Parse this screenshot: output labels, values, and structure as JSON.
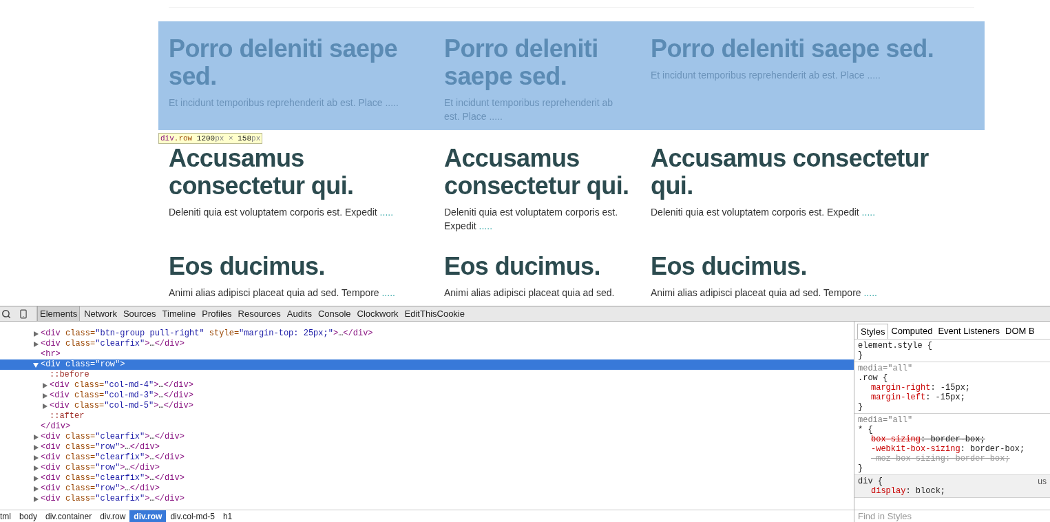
{
  "page": {
    "rows": [
      {
        "highlighted": true,
        "columns": [
          {
            "heading": "Porro deleniti saepe sed.",
            "text": "Et incidunt temporibus reprehenderit ab est. Place",
            "link": "....."
          },
          {
            "heading": "Porro deleniti saepe sed.",
            "text": "Et incidunt temporibus reprehenderit ab est. Place",
            "link": "....."
          },
          {
            "heading": "Porro deleniti saepe sed.",
            "text": "Et incidunt temporibus reprehenderit ab est. Place",
            "link": "....."
          }
        ]
      },
      {
        "highlighted": false,
        "columns": [
          {
            "heading": "Accusamus consectetur qui.",
            "text": "Deleniti quia est voluptatem corporis est. Expedit",
            "link": "....."
          },
          {
            "heading": "Accusamus consectetur qui.",
            "text": "Deleniti quia est voluptatem corporis est. Expedit",
            "link": "....."
          },
          {
            "heading": "Accusamus consectetur qui.",
            "text": "Deleniti quia est voluptatem corporis est. Expedit",
            "link": "....."
          }
        ]
      },
      {
        "highlighted": false,
        "columns": [
          {
            "heading": "Eos ducimus.",
            "text": "Animi alias adipisci placeat quia ad sed. Tempore",
            "link": "....."
          },
          {
            "heading": "Eos ducimus.",
            "text": "Animi alias adipisci placeat quia ad sed."
          },
          {
            "heading": "Eos ducimus.",
            "text": "Animi alias adipisci placeat quia ad sed. Tempore",
            "link": "....."
          }
        ]
      }
    ],
    "tooltip": [
      {
        "kind": "tag",
        "text": "div"
      },
      {
        "kind": "class",
        "text": ".row"
      },
      {
        "kind": "number",
        "text": " 1200"
      },
      {
        "kind": "unit",
        "text": "px"
      },
      {
        "kind": "unit",
        "text": " × "
      },
      {
        "kind": "number",
        "text": "158"
      },
      {
        "kind": "unit",
        "text": "px"
      }
    ]
  },
  "devtools": {
    "tabs": [
      {
        "label": "Elements",
        "selected": true
      },
      {
        "label": "Network",
        "selected": false
      },
      {
        "label": "Sources",
        "selected": false
      },
      {
        "label": "Timeline",
        "selected": false
      },
      {
        "label": "Profiles",
        "selected": false
      },
      {
        "label": "Resources",
        "selected": false
      },
      {
        "label": "Audits",
        "selected": false
      },
      {
        "label": "Console",
        "selected": false
      },
      {
        "label": "Clockwork",
        "selected": false
      },
      {
        "label": "EditThisCookie",
        "selected": false
      }
    ],
    "dom_tree": [
      {
        "kind": "element",
        "text": "<div class=\"btn-group pull-right\" style=\"margin-top: 25px;\">…</div>",
        "expanded": false,
        "selected": false
      },
      {
        "kind": "element",
        "text": "<div class=\"clearfix\">…</div>",
        "expanded": false,
        "selected": false
      },
      {
        "kind": "leaf",
        "text": "<hr>"
      },
      {
        "kind": "element",
        "text": "<div class=\"row\">",
        "expanded": true,
        "selected": true,
        "closing": "</div>",
        "children": [
          {
            "kind": "pseudo",
            "text": "::before"
          },
          {
            "kind": "element",
            "text": "<div class=\"col-md-4\">…</div>",
            "expanded": false,
            "selected": false
          },
          {
            "kind": "element",
            "text": "<div class=\"col-md-3\">…</div>",
            "expanded": false,
            "selected": false
          },
          {
            "kind": "element",
            "text": "<div class=\"col-md-5\">…</div>",
            "expanded": false,
            "selected": false
          },
          {
            "kind": "pseudo",
            "text": "::after"
          }
        ]
      },
      {
        "kind": "element",
        "text": "<div class=\"clearfix\">…</div>",
        "expanded": false,
        "selected": false
      },
      {
        "kind": "element",
        "text": "<div class=\"row\">…</div>",
        "expanded": false,
        "selected": false
      },
      {
        "kind": "element",
        "text": "<div class=\"clearfix\">…</div>",
        "expanded": false,
        "selected": false
      },
      {
        "kind": "element",
        "text": "<div class=\"row\">…</div>",
        "expanded": false,
        "selected": false
      },
      {
        "kind": "element",
        "text": "<div class=\"clearfix\">…</div>",
        "expanded": false,
        "selected": false
      },
      {
        "kind": "element",
        "text": "<div class=\"row\">…</div>",
        "expanded": false,
        "selected": false
      },
      {
        "kind": "element",
        "text": "<div class=\"clearfix\">…</div>",
        "expanded": false,
        "selected": false
      }
    ],
    "breadcrumbs": [
      {
        "label": "tml",
        "selected": false
      },
      {
        "label": "body",
        "selected": false
      },
      {
        "label": "div.container",
        "selected": false
      },
      {
        "label": "div.row",
        "selected": false
      },
      {
        "label": "div.row",
        "selected": true
      },
      {
        "label": "div.col-md-5",
        "selected": false
      },
      {
        "label": "h1",
        "selected": false
      }
    ],
    "styles": {
      "tabs": [
        {
          "label": "Styles",
          "selected": true
        },
        {
          "label": "Computed",
          "selected": false
        },
        {
          "label": "Event Listeners",
          "selected": false
        },
        {
          "label": "DOM B",
          "selected": false
        }
      ],
      "rules": [
        {
          "kind": "author",
          "selector": "element.style {",
          "close": "}"
        },
        {
          "kind": "author",
          "media": "media=\"all\"",
          "selector": ".row {",
          "close": "}",
          "properties": [
            {
              "name": "margin-right",
              "value": ": -15px;",
              "overridden": false,
              "supported": true
            },
            {
              "name": "margin-left",
              "value": ": -15px;",
              "overridden": false,
              "supported": true
            }
          ]
        },
        {
          "kind": "author",
          "media": "media=\"all\"",
          "selector": "* {",
          "close": "}",
          "properties": [
            {
              "name": "box-sizing",
              "value": ": border-box;",
              "overridden": true,
              "supported": true
            },
            {
              "name": "-webkit-box-sizing",
              "value": ": border-box;",
              "overridden": false,
              "supported": true
            },
            {
              "name": "-moz-box-sizing",
              "value": ": border-box;",
              "overridden": true,
              "supported": false
            }
          ]
        },
        {
          "kind": "user_agent",
          "selector": "div {",
          "origin": "us",
          "properties": [
            {
              "name": "display",
              "value": ": block;",
              "overridden": false,
              "supported": true
            }
          ]
        }
      ],
      "filter_placeholder": "Find in Styles"
    }
  }
}
